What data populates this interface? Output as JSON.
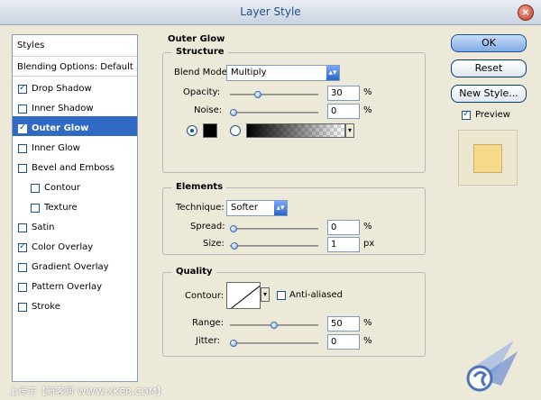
{
  "window": {
    "title": "Layer Style",
    "close_icon": "close-icon"
  },
  "styles_panel": {
    "header": "Styles",
    "blending": "Blending Options: Default",
    "items": [
      {
        "label": "Drop Shadow",
        "checked": true,
        "selected": false,
        "indent": false
      },
      {
        "label": "Inner Shadow",
        "checked": false,
        "selected": false,
        "indent": false
      },
      {
        "label": "Outer Glow",
        "checked": true,
        "selected": true,
        "indent": false
      },
      {
        "label": "Inner Glow",
        "checked": false,
        "selected": false,
        "indent": false
      },
      {
        "label": "Bevel and Emboss",
        "checked": false,
        "selected": false,
        "indent": false
      },
      {
        "label": "Contour",
        "checked": false,
        "selected": false,
        "indent": true
      },
      {
        "label": "Texture",
        "checked": false,
        "selected": false,
        "indent": true
      },
      {
        "label": "Satin",
        "checked": false,
        "selected": false,
        "indent": false
      },
      {
        "label": "Color Overlay",
        "checked": true,
        "selected": false,
        "indent": false
      },
      {
        "label": "Gradient Overlay",
        "checked": false,
        "selected": false,
        "indent": false
      },
      {
        "label": "Pattern Overlay",
        "checked": false,
        "selected": false,
        "indent": false
      },
      {
        "label": "Stroke",
        "checked": false,
        "selected": false,
        "indent": false
      }
    ]
  },
  "buttons": {
    "ok": "OK",
    "reset": "Reset",
    "new_style": "New Style...",
    "preview_label": "Preview",
    "preview_checked": true
  },
  "outer_glow": {
    "title": "Outer Glow",
    "structure": {
      "label": "Structure",
      "blend_mode_label": "Blend Mode:",
      "blend_mode_value": "Multiply",
      "opacity_label": "Opacity:",
      "opacity_value": "30",
      "opacity_level": 0.3,
      "noise_label": "Noise:",
      "noise_value": "0",
      "noise_level": 0.0,
      "percent": "%",
      "color_mode": "solid",
      "glow_color": "#000000"
    },
    "elements": {
      "label": "Elements",
      "technique_label": "Technique:",
      "technique_value": "Softer",
      "spread_label": "Spread:",
      "spread_value": "0",
      "spread_level": 0.0,
      "size_label": "Size:",
      "size_value": "1",
      "size_level": 0.01,
      "percent": "%",
      "px": "px"
    },
    "quality": {
      "label": "Quality",
      "contour_label": "Contour:",
      "anti_aliased_label": "Anti-aliased",
      "anti_aliased_checked": false,
      "range_label": "Range:",
      "range_value": "50",
      "range_level": 0.5,
      "jitter_label": "Jitter:",
      "jitter_value": "0",
      "jitter_level": 0.0,
      "percent": "%"
    }
  },
  "preview_swatch_color": "#f7d98b",
  "watermark": "上传于【新客网 WWW.XKER.COM】"
}
